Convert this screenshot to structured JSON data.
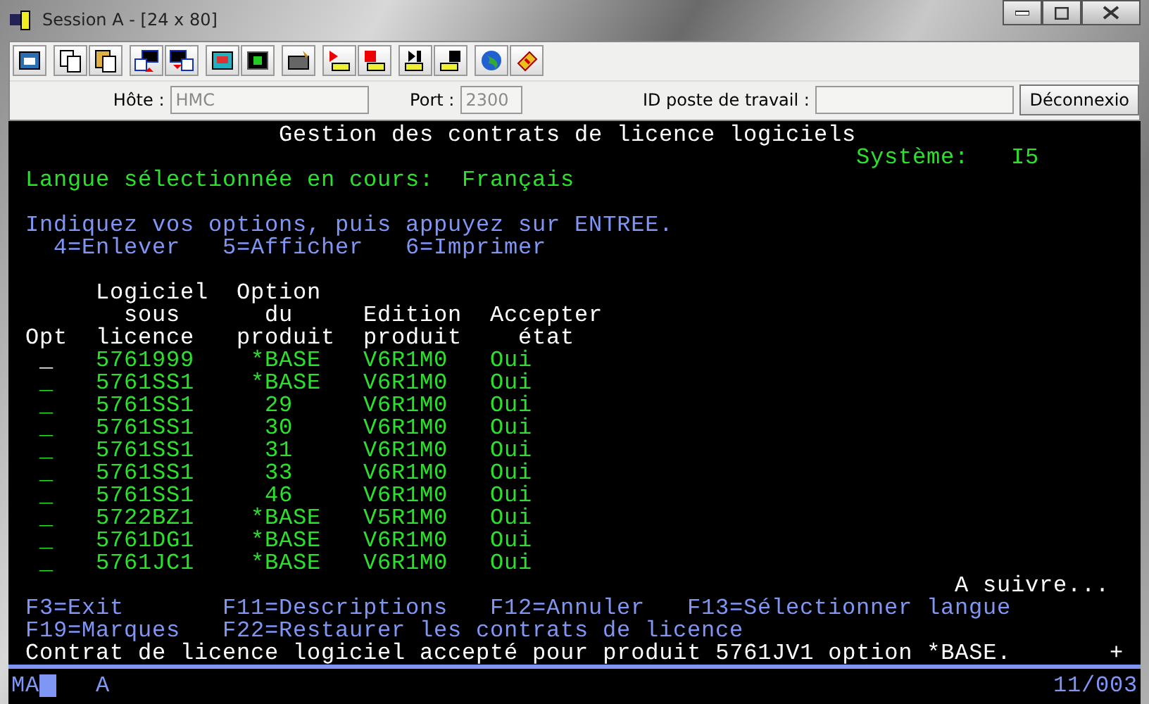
{
  "window": {
    "title": "Session A - [24 x 80]"
  },
  "connection": {
    "host_label": "Hôte :",
    "host": "HMC",
    "port_label": "Port :",
    "port": "2300",
    "workstation_label": "ID poste de travail :",
    "disconnect": "Déconnexio"
  },
  "screen": {
    "title": "Gestion des contrats de licence logiciels",
    "system_label": "Système:",
    "system": "I5",
    "language_label": "Langue sélectionnée en cours:",
    "language": "Français",
    "instructions": "Indiquez vos options, puis appuyez sur ENTREE.",
    "options": [
      "4=Enlever",
      "5=Afficher",
      "6=Imprimer"
    ],
    "columns": [
      {
        "lines": [
          "Opt"
        ]
      },
      {
        "lines": [
          "Logiciel",
          "sous",
          "licence"
        ]
      },
      {
        "lines": [
          "Option",
          "du",
          "produit"
        ]
      },
      {
        "lines": [
          "Edition",
          "produit"
        ]
      },
      {
        "lines": [
          "Accepter",
          "état"
        ]
      }
    ],
    "rows": [
      {
        "opt": "_",
        "cursor": true,
        "product": "5761999",
        "option": "*BASE",
        "release": "V6R1M0",
        "accepted": "Oui"
      },
      {
        "opt": "_",
        "cursor": false,
        "product": "5761SS1",
        "option": "*BASE",
        "release": "V6R1M0",
        "accepted": "Oui"
      },
      {
        "opt": "_",
        "cursor": false,
        "product": "5761SS1",
        "option": "29",
        "release": "V6R1M0",
        "accepted": "Oui"
      },
      {
        "opt": "_",
        "cursor": false,
        "product": "5761SS1",
        "option": "30",
        "release": "V6R1M0",
        "accepted": "Oui"
      },
      {
        "opt": "_",
        "cursor": false,
        "product": "5761SS1",
        "option": "31",
        "release": "V6R1M0",
        "accepted": "Oui"
      },
      {
        "opt": "_",
        "cursor": false,
        "product": "5761SS1",
        "option": "33",
        "release": "V6R1M0",
        "accepted": "Oui"
      },
      {
        "opt": "_",
        "cursor": false,
        "product": "5761SS1",
        "option": "46",
        "release": "V6R1M0",
        "accepted": "Oui"
      },
      {
        "opt": "_",
        "cursor": false,
        "product": "5722BZ1",
        "option": "*BASE",
        "release": "V5R1M0",
        "accepted": "Oui"
      },
      {
        "opt": "_",
        "cursor": false,
        "product": "5761DG1",
        "option": "*BASE",
        "release": "V6R1M0",
        "accepted": "Oui"
      },
      {
        "opt": "_",
        "cursor": false,
        "product": "5761JC1",
        "option": "*BASE",
        "release": "V6R1M0",
        "accepted": "Oui"
      }
    ],
    "more": "A suivre...",
    "function_keys": [
      [
        "F3=Exit",
        "F11=Descriptions",
        "F12=Annuler",
        "F13=Sélectionner langue"
      ],
      [
        "F19=Marques",
        "F22=Restaurer les contrats de licence"
      ]
    ],
    "message": "Contrat de licence logiciel accepté pour produit 5761JV1 option *BASE.",
    "message_more": "+"
  },
  "status_bar": {
    "mode": "MA",
    "indicator": "A",
    "position": "11/003"
  }
}
